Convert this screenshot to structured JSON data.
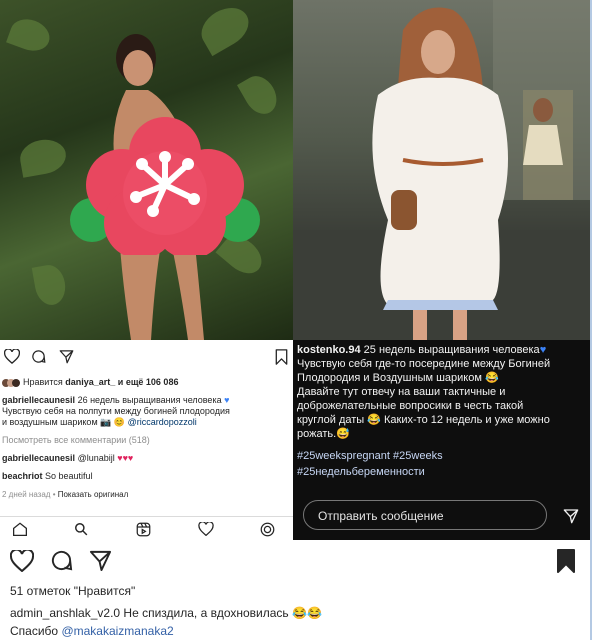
{
  "left_post": {
    "likes_text": "Нравится",
    "liked_by": "daniya_art_",
    "likes_rest": "и ещё 106 086",
    "caption_user": "gabriellecaunesil",
    "caption_line1": "26 недель выращивания человека",
    "caption_line2": "Чувствую себя на полпути между богиней плодородия",
    "caption_line3": "и воздушным шариком",
    "caption_mention": "@riccardopozzoli",
    "view_comments": "Посмотреть все комментарии (518)",
    "comments": [
      {
        "user": "gabriellecaunesil",
        "text": "@lunabijl",
        "hearts": "♥♥♥"
      },
      {
        "user": "beachriot",
        "text": "So beautiful",
        "hearts": ""
      }
    ],
    "time_ago": "2 дней назад",
    "show_original": "Показать оригинал",
    "icons": {
      "like": "heart-icon",
      "comment": "comment-icon",
      "share": "send-icon",
      "save": "bookmark-icon"
    },
    "nav_icons": [
      "home-icon",
      "search-icon",
      "reels-icon",
      "heart-icon",
      "profile-icon"
    ]
  },
  "right_post": {
    "caption_user": "kostenko.94",
    "caption_lines": [
      "25 недель выращивания человека",
      "Чувствую себя где-то посередине между Богиней",
      "Плодородия и Воздушным шариком",
      "Давайте тут отвечу на ваши тактичные и",
      "доброжелательные вопросики в честь такой",
      "круглой  даты",
      "Каких-то 12 недель и уже можно",
      "рожать."
    ],
    "hashtags": [
      "#25weekspregnant",
      "#25weeks",
      "#25недельбеременности"
    ],
    "message_placeholder": "Отправить сообщение"
  },
  "bottom_post": {
    "likes": "51 отметок \"Нравится\"",
    "caption_user": "admin_anshlak_v2.0",
    "caption_text": "Не спиздила, а вдохновилась",
    "caption_emoji": "😂😂",
    "comment_prefix": "Спасибо",
    "comment_mention": "@makakaizmanaka2"
  },
  "colors": {
    "accent_blue": "#3360a6",
    "heart_red": "#e0245e",
    "censor_red": "#e8475f",
    "censor_green": "#2fa84f",
    "dark_panel": "#0e0e0e"
  }
}
